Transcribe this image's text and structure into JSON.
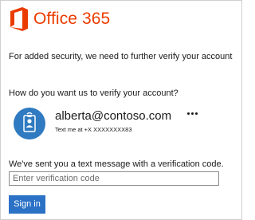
{
  "brand": {
    "name": "Office 365",
    "icon": "office-logo-icon",
    "color": "#eb3c00"
  },
  "message": "For added security, we need to further verify your account",
  "question": "How do you want us to verify your account?",
  "account": {
    "email": "alberta@contoso.com",
    "method": "Text me at +X XXXXXXXX83",
    "avatar_icon": "id-badge-icon",
    "avatar_color": "#2f7ac0",
    "more_icon": "more-options-icon"
  },
  "verification": {
    "sent_text": "We've sent you a text message with a verification code.",
    "placeholder": "Enter verification code",
    "value": ""
  },
  "actions": {
    "sign_in_label": "Sign in",
    "sign_in_color": "#2b72c6"
  }
}
